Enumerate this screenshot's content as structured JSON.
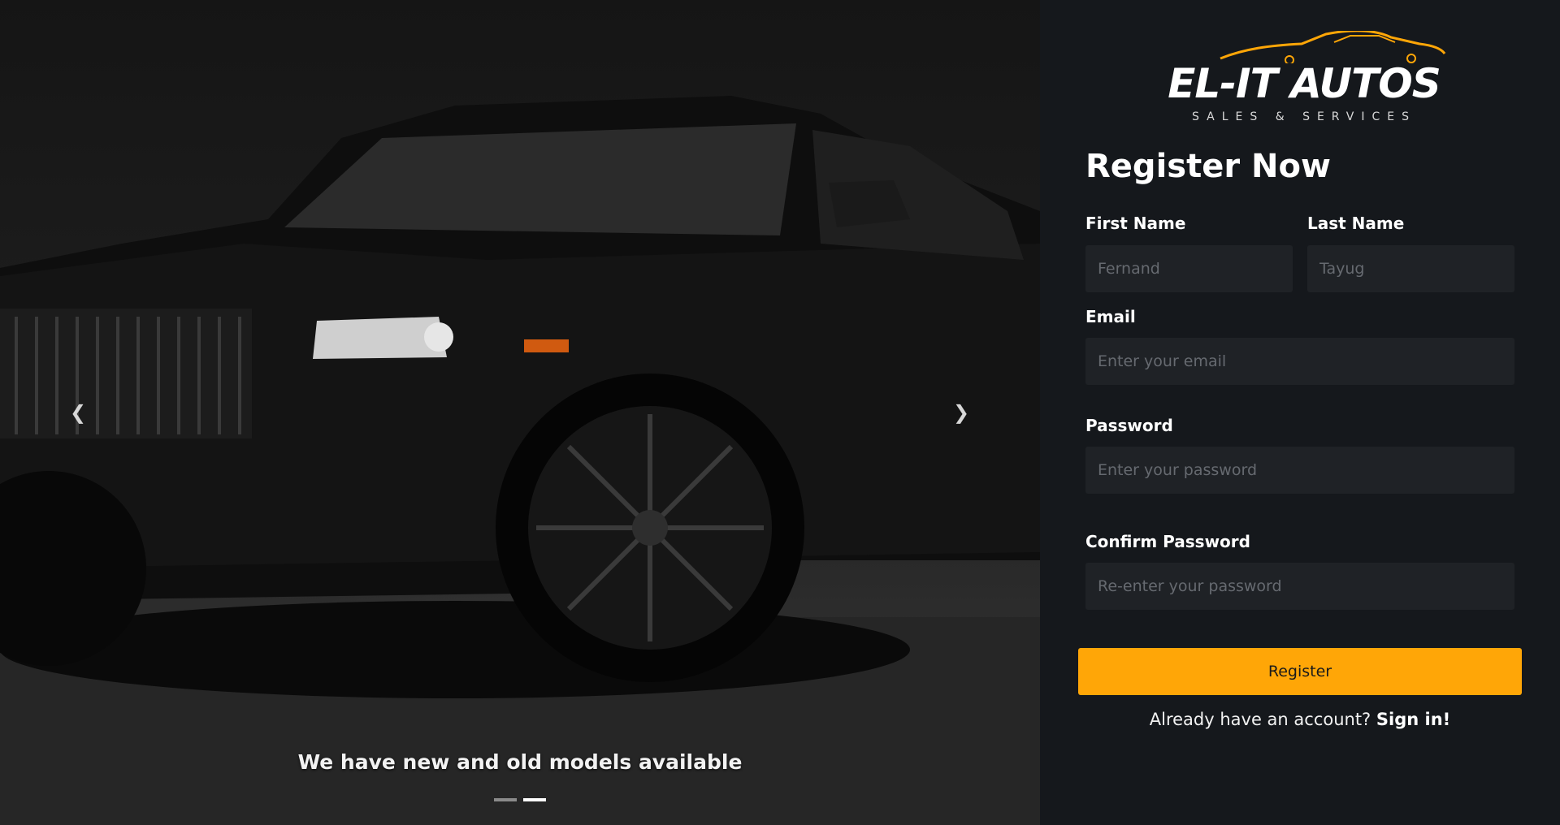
{
  "carousel": {
    "caption": "We have new and old models available",
    "prev_icon": "chevron-left-icon",
    "next_icon": "chevron-right-icon",
    "slide_count": 2,
    "active_slide": 2
  },
  "brand": {
    "name": "EL-IT AUTOS",
    "tagline": "SALES & SERVICES",
    "logo_icon": "car-silhouette-icon",
    "accent_color": "#ffa607"
  },
  "form": {
    "heading": "Register Now",
    "first_name": {
      "label": "First Name",
      "placeholder": "Fernand",
      "value": ""
    },
    "last_name": {
      "label": "Last Name",
      "placeholder": "Tayug",
      "value": ""
    },
    "email": {
      "label": "Email",
      "placeholder": "Enter your email",
      "value": ""
    },
    "password": {
      "label": "Password",
      "placeholder": "Enter your password",
      "value": ""
    },
    "confirm_password": {
      "label": "Confirm Password",
      "placeholder": "Re-enter your password",
      "value": ""
    },
    "submit_label": "Register",
    "signin_prompt": "Already have an account?",
    "signin_link": "Sign in!"
  }
}
